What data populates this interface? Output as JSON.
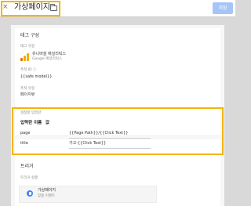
{
  "header": {
    "close_icon": "×",
    "title": "가상페이지",
    "folder_icon": "folder-icon",
    "save_label": "저장"
  },
  "tag_config": {
    "section_title": "태그 구성",
    "tag_type_label": "태그 유형",
    "tag_type_name": "유니버설 애널리틱스",
    "tag_type_vendor": "Google 애널리틱스",
    "tracking_id_label": "추적 ID ⓘ",
    "tracking_id_value": "{{safe model}}",
    "track_type_label": "추적 유형",
    "track_type_value": "페이지뷰",
    "vars": {
      "label": "설정할 입력란",
      "header_name": "입력란 이름",
      "header_value": "값",
      "rows": [
        {
          "name": "page",
          "value": "{{Page Path}}/{{Click Text}}"
        },
        {
          "name": "title",
          "value": "가고-{{Click Text}}"
        }
      ]
    }
  },
  "triggering": {
    "section_title": "트리거",
    "fire_label": "트리거 실행",
    "trigger_name": "가상페이지",
    "trigger_type": "맞춤 이벤트"
  },
  "colors": {
    "highlight": "#f4b400",
    "accent_blue": "#4285f4",
    "save_button": "#a6c5f7"
  }
}
